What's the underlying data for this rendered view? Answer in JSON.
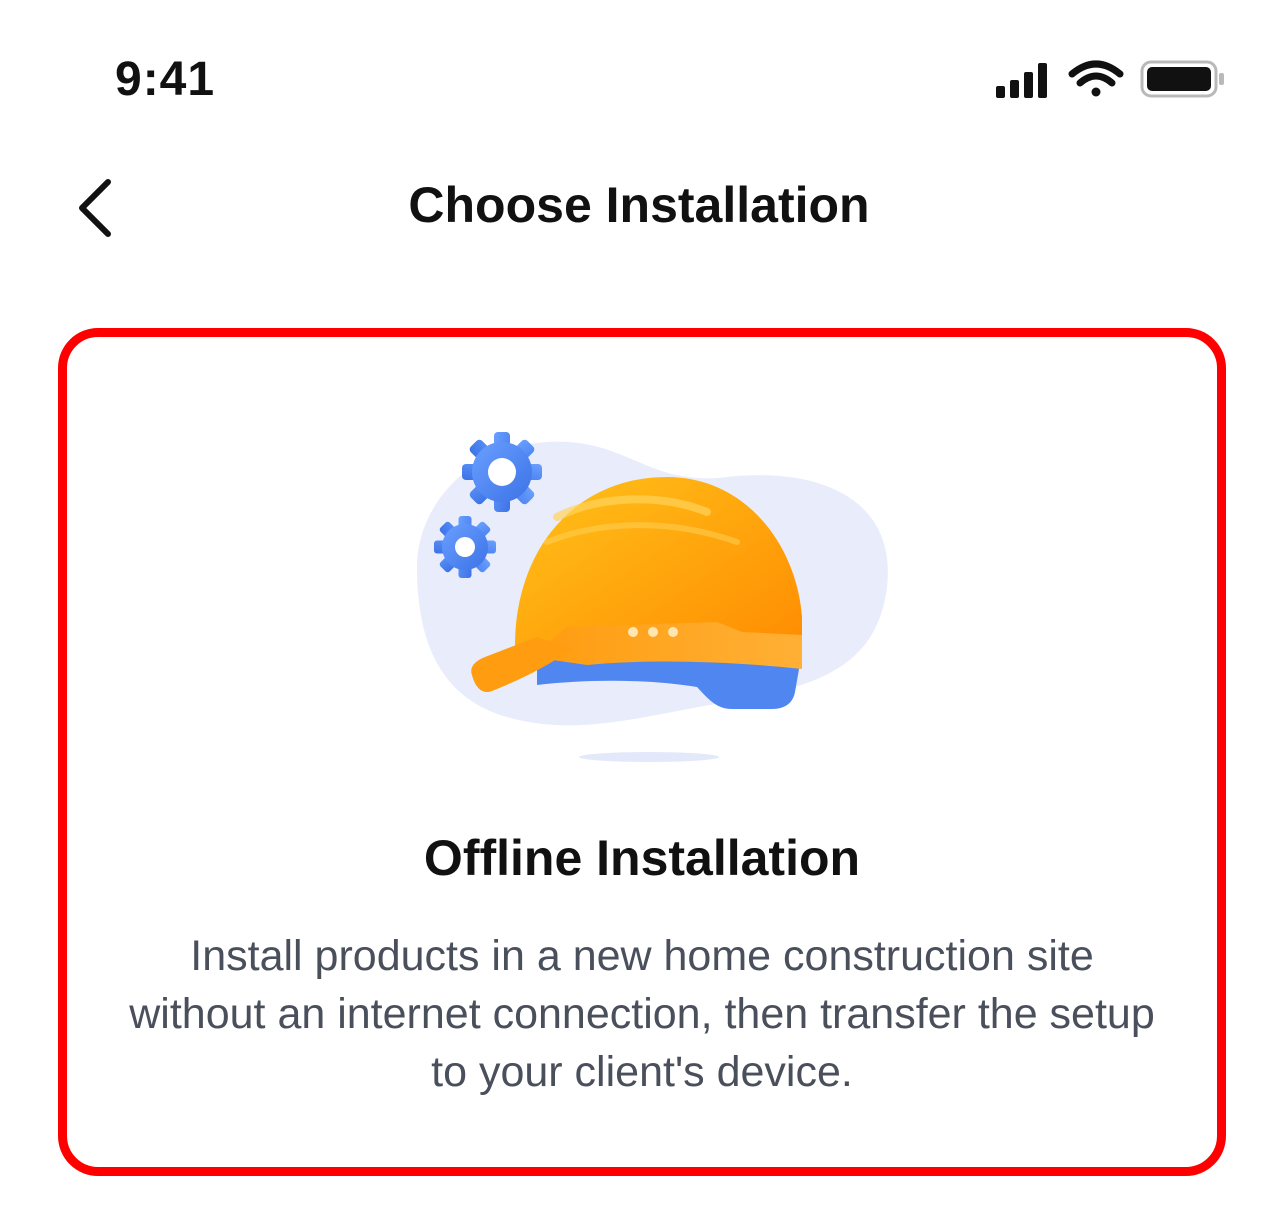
{
  "status_bar": {
    "time": "9:41",
    "icons": [
      "signal-icon",
      "wifi-icon",
      "battery-icon"
    ]
  },
  "nav": {
    "back_icon": "chevron-left-icon",
    "title": "Choose Installation"
  },
  "option_card": {
    "illustration_icon": "hard-hat-icon",
    "title": "Offline Installation",
    "description": "Install products in a new home construction site without an internet connection, then transfer the setup to your client's device.",
    "highlight_color": "#ff0000"
  },
  "colors": {
    "hat_orange": "#ffa70f",
    "hat_blue": "#4f86f0",
    "gear_blue": "#4a86f0",
    "blob_bg": "#e9edfb",
    "description_text": "#4a4f5c"
  }
}
